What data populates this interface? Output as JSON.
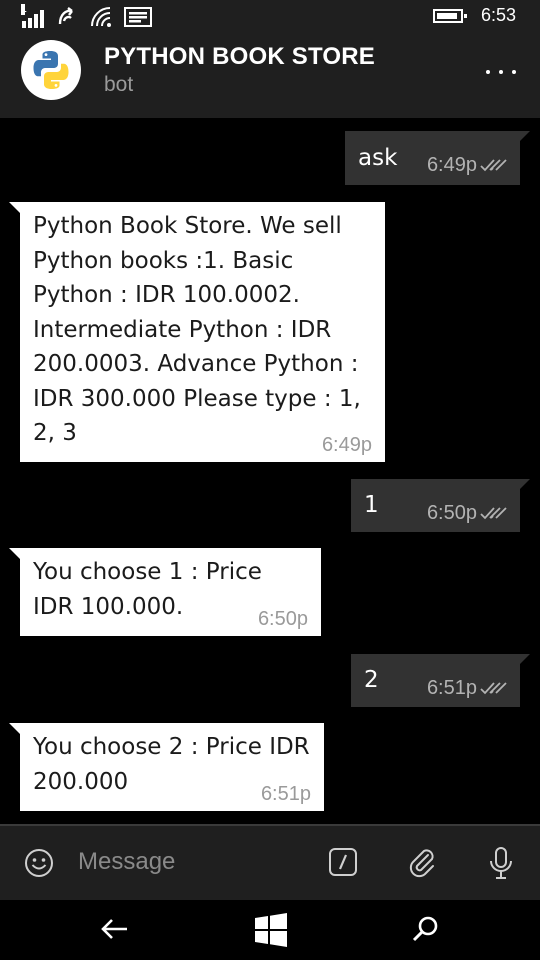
{
  "status_bar": {
    "signal_label": "1",
    "time": "6:53"
  },
  "header": {
    "title": "PYTHON BOOK STORE",
    "subtitle": "bot",
    "avatar_icon": "python-logo-icon",
    "menu_icon": "more-dots-icon"
  },
  "messages": [
    {
      "direction": "out",
      "text": "ask",
      "time": "6:49p",
      "status_icon": "double-check-icon"
    },
    {
      "direction": "in",
      "text": "Python Book Store. We sell Python books :1. Basic Python :  IDR 100.0002. Intermediate Python : IDR 200.0003. Advance Python : IDR 300.000 Please type : 1, 2, 3",
      "time": "6:49p"
    },
    {
      "direction": "out",
      "text": "1",
      "time": "6:50p",
      "status_icon": "double-check-icon"
    },
    {
      "direction": "in",
      "text": "You choose 1 : Price IDR 100.000.",
      "time": "6:50p"
    },
    {
      "direction": "out",
      "text": "2",
      "time": "6:51p",
      "status_icon": "double-check-icon"
    },
    {
      "direction": "in",
      "text": "You choose 2 : Price IDR 200.000",
      "time": "6:51p"
    }
  ],
  "composer": {
    "placeholder": "Message",
    "icons": [
      "emoji-icon",
      "bot-command-icon",
      "attach-icon",
      "microphone-icon"
    ]
  },
  "nav": {
    "icons": [
      "back-arrow-icon",
      "windows-start-icon",
      "search-icon"
    ]
  },
  "colors": {
    "background": "#000000",
    "bar": "#1f1f1f",
    "outgoing_bubble": "#323232",
    "incoming_bubble": "#ffffff",
    "python_blue": "#3a75b0",
    "python_yellow": "#ffd43b"
  }
}
